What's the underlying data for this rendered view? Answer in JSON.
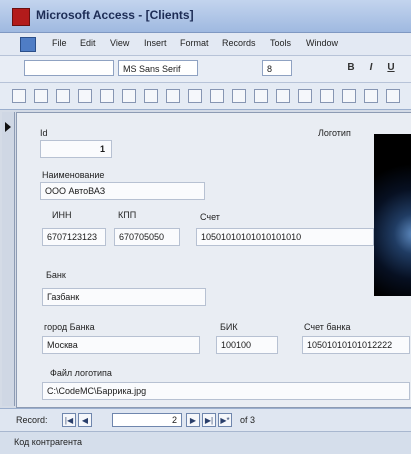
{
  "window": {
    "title": "Microsoft Access - [Clients]"
  },
  "menu": [
    "File",
    "Edit",
    "View",
    "Insert",
    "Format",
    "Records",
    "Tools",
    "Window"
  ],
  "format_toolbar": {
    "object_combo": "",
    "font_combo": "MS Sans Serif",
    "size_combo": "8",
    "bold": "B",
    "italic": "I",
    "underline": "U"
  },
  "form": {
    "id": {
      "label": "Id",
      "value": "1"
    },
    "logo_label": "Логотип",
    "name": {
      "label": "Наименование",
      "value": "ООО АвтоВАЗ"
    },
    "inn": {
      "label": "ИНН",
      "value": "6707123123"
    },
    "kpp": {
      "label": "КПП",
      "value": "670705050"
    },
    "account": {
      "label": "Счет",
      "value": "10501010101010101010"
    },
    "bank": {
      "label": "Банк",
      "value": "Газбанк"
    },
    "bank_city": {
      "label": "город Банка",
      "value": "Москва"
    },
    "bik": {
      "label": "БИК",
      "value": "100100"
    },
    "bank_account": {
      "label": "Счет банка",
      "value": "10501010101012222"
    },
    "logo_file": {
      "label": "Файл логотипа",
      "value": "C:\\CodeMC\\Баррика.jpg"
    }
  },
  "navigation": {
    "record_label": "Record:",
    "current": "2",
    "total_text": "of 3"
  },
  "status": {
    "text": "Код контрагента"
  },
  "colors": {
    "titlebar": "#9fb9e0",
    "form_bg": "#e9edf3",
    "field_bg": "#fafbfd"
  }
}
